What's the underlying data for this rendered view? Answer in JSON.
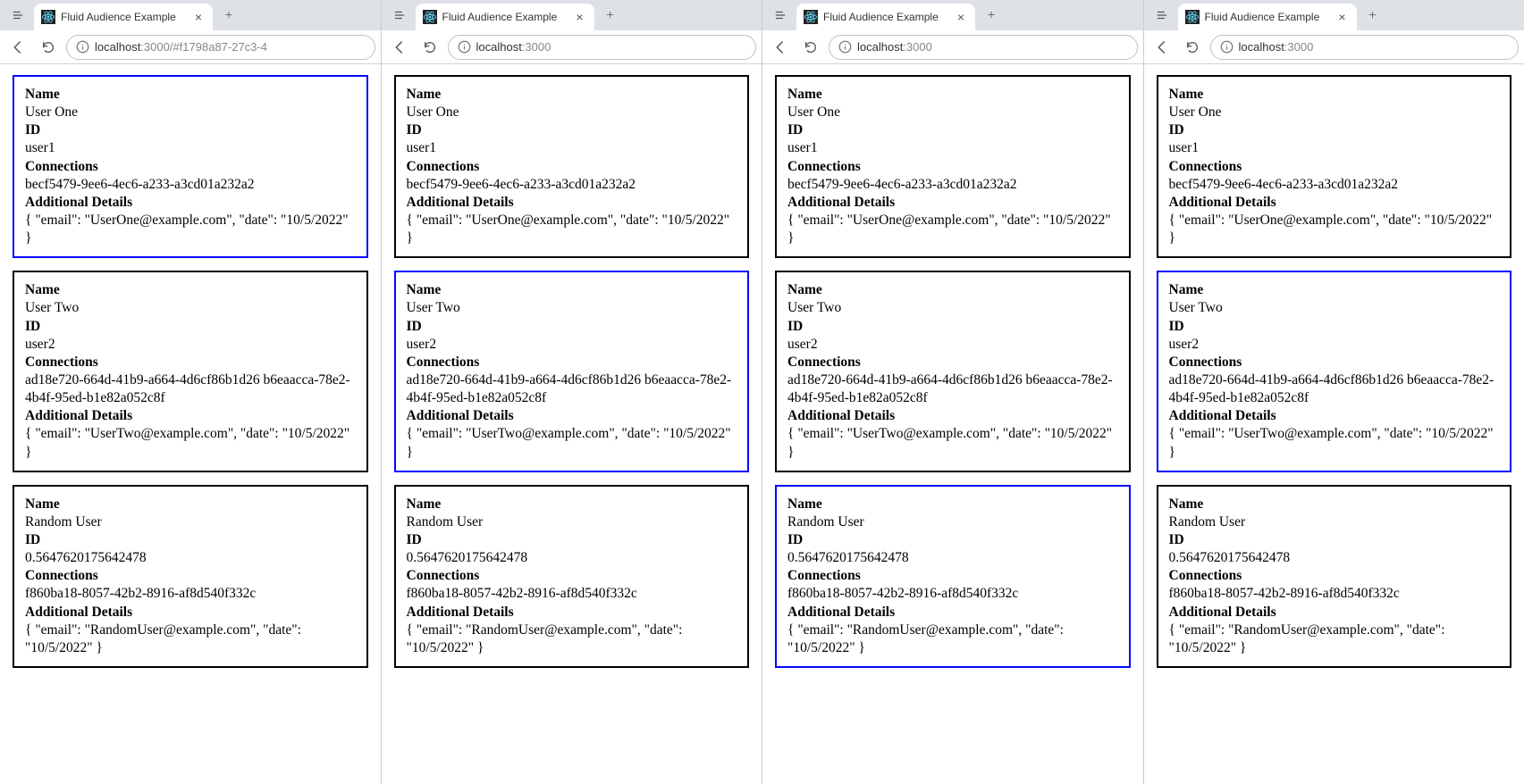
{
  "windows": [
    {
      "tab_title": "Fluid Audience Example",
      "url_display_prefix": "localhost",
      "url_display_suffix": ":3000/#f1798a87-27c3-4",
      "active_index": 0
    },
    {
      "tab_title": "Fluid Audience Example",
      "url_display_prefix": "localhost",
      "url_display_suffix": ":3000",
      "active_index": 1
    },
    {
      "tab_title": "Fluid Audience Example",
      "url_display_prefix": "localhost",
      "url_display_suffix": ":3000",
      "active_index": 2
    },
    {
      "tab_title": "Fluid Audience Example",
      "url_display_prefix": "localhost",
      "url_display_suffix": ":3000",
      "active_index": 1
    }
  ],
  "labels": {
    "name": "Name",
    "id": "ID",
    "connections": "Connections",
    "details": "Additional Details"
  },
  "users": [
    {
      "name": "User One",
      "id": "user1",
      "connections": "becf5479-9ee6-4ec6-a233-a3cd01a232a2",
      "details": "{ \"email\": \"UserOne@example.com\", \"date\": \"10/5/2022\" }"
    },
    {
      "name": "User Two",
      "id": "user2",
      "connections": "ad18e720-664d-41b9-a664-4d6cf86b1d26 b6eaacca-78e2-4b4f-95ed-b1e82a052c8f",
      "details": "{ \"email\": \"UserTwo@example.com\", \"date\": \"10/5/2022\" }"
    },
    {
      "name": "Random User",
      "id": "0.5647620175642478",
      "connections": "f860ba18-8057-42b2-8916-af8d540f332c",
      "details": "{ \"email\": \"RandomUser@example.com\", \"date\": \"10/5/2022\" }"
    }
  ]
}
